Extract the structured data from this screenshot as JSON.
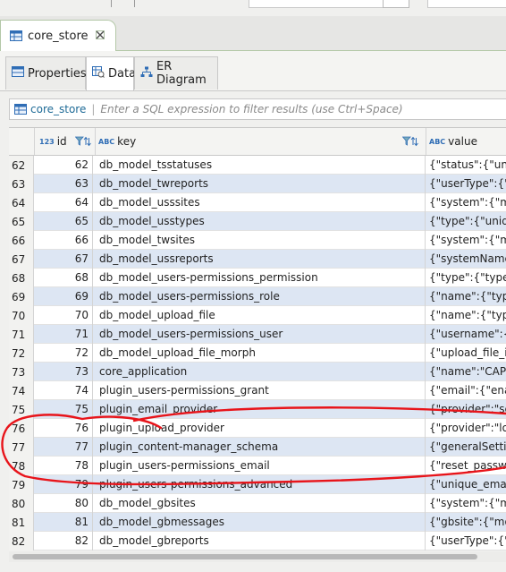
{
  "editor_tab": {
    "title": "core_store"
  },
  "subtabs": [
    {
      "label": "Properties"
    },
    {
      "label": "Data"
    },
    {
      "label": "ER Diagram"
    }
  ],
  "filter": {
    "table_name": "core_store",
    "placeholder": "Enter a SQL expression to filter results (use Ctrl+Space)"
  },
  "columns": {
    "id": {
      "type_badge": "123",
      "label": "id"
    },
    "key": {
      "type_badge": "ABC",
      "label": "key"
    },
    "value": {
      "type_badge": "ABC",
      "label": "value"
    }
  },
  "rows": [
    {
      "rownum": "62",
      "id": "62",
      "key": "db_model_tsstatuses",
      "value": "{\"status\":{\"uniq"
    },
    {
      "rownum": "63",
      "id": "63",
      "key": "db_model_twreports",
      "value": "{\"userType\":{\"d"
    },
    {
      "rownum": "64",
      "id": "64",
      "key": "db_model_usssites",
      "value": "{\"system\":{\"mo"
    },
    {
      "rownum": "65",
      "id": "65",
      "key": "db_model_usstypes",
      "value": "{\"type\":{\"unique"
    },
    {
      "rownum": "66",
      "id": "66",
      "key": "db_model_twsites",
      "value": "{\"system\":{\"mo"
    },
    {
      "rownum": "67",
      "id": "67",
      "key": "db_model_ussreports",
      "value": "{\"systemName\""
    },
    {
      "rownum": "68",
      "id": "68",
      "key": "db_model_users-permissions_permission",
      "value": "{\"type\":{\"type\""
    },
    {
      "rownum": "69",
      "id": "69",
      "key": "db_model_users-permissions_role",
      "value": "{\"name\":{\"type"
    },
    {
      "rownum": "70",
      "id": "70",
      "key": "db_model_upload_file",
      "value": "{\"name\":{\"type"
    },
    {
      "rownum": "71",
      "id": "71",
      "key": "db_model_users-permissions_user",
      "value": "{\"username\":{\""
    },
    {
      "rownum": "72",
      "id": "72",
      "key": "db_model_upload_file_morph",
      "value": "{\"upload_file_id"
    },
    {
      "rownum": "73",
      "id": "73",
      "key": "core_application",
      "value": "{\"name\":\"CAPIv"
    },
    {
      "rownum": "74",
      "id": "74",
      "key": "plugin_users-permissions_grant",
      "value": "{\"email\":{\"enab"
    },
    {
      "rownum": "75",
      "id": "75",
      "key": "plugin_email_provider",
      "value": "{\"provider\":\"ser"
    },
    {
      "rownum": "76",
      "id": "76",
      "key": "plugin_upload_provider",
      "value": "{\"provider\":\"loc"
    },
    {
      "rownum": "77",
      "id": "77",
      "key": "plugin_content-manager_schema",
      "value": "{\"generalSettin"
    },
    {
      "rownum": "78",
      "id": "78",
      "key": "plugin_users-permissions_email",
      "value": "{\"reset_passwo"
    },
    {
      "rownum": "79",
      "id": "79",
      "key": "plugin_users-permissions_advanced",
      "value": "{\"unique_email\""
    },
    {
      "rownum": "80",
      "id": "80",
      "key": "db_model_gbsites",
      "value": "{\"system\":{\"mo"
    },
    {
      "rownum": "81",
      "id": "81",
      "key": "db_model_gbmessages",
      "value": "{\"gbsite\":{\"mod"
    },
    {
      "rownum": "82",
      "id": "82",
      "key": "db_model_gbreports",
      "value": "{\"userType\":{\"d"
    }
  ],
  "colors": {
    "accent": "#1d6a96",
    "row_alt": "#dde6f3",
    "annotation": "#e8141a"
  }
}
